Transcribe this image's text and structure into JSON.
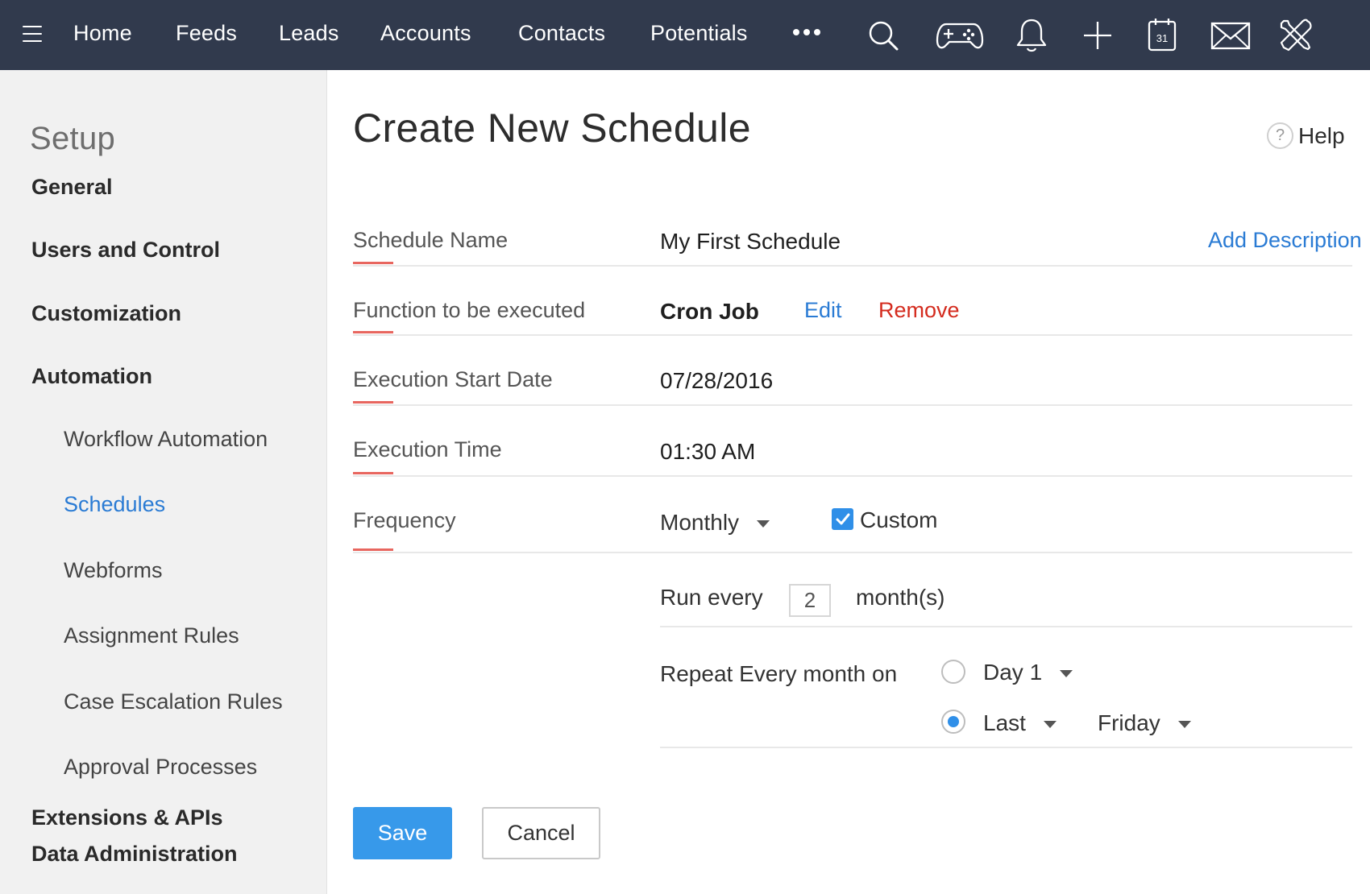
{
  "topbar": {
    "nav": [
      "Home",
      "Feeds",
      "Leads",
      "Accounts",
      "Contacts",
      "Potentials"
    ],
    "icons": [
      "menu-icon",
      "more-icon",
      "search-icon",
      "gamepad-icon",
      "bell-icon",
      "plus-icon",
      "calendar-icon",
      "mail-icon",
      "tools-icon"
    ],
    "calendar_day": "31",
    "background": "#313a4d"
  },
  "sidebar": {
    "title": "Setup",
    "sections": [
      {
        "label": "General"
      },
      {
        "label": "Users and Control"
      },
      {
        "label": "Customization"
      },
      {
        "label": "Automation"
      }
    ],
    "automation_items": [
      {
        "label": "Workflow Automation",
        "active": false
      },
      {
        "label": "Schedules",
        "active": true
      },
      {
        "label": "Webforms",
        "active": false
      },
      {
        "label": "Assignment Rules",
        "active": false
      },
      {
        "label": "Case Escalation Rules",
        "active": false
      },
      {
        "label": "Approval Processes",
        "active": false
      }
    ],
    "bottom_sections": [
      {
        "label": "Extensions & APIs"
      },
      {
        "label": "Data Administration"
      }
    ]
  },
  "main": {
    "title": "Create New Schedule",
    "help_label": "Help",
    "help_icon": "?",
    "fields": {
      "schedule_name": {
        "label": "Schedule Name",
        "value": "My First Schedule",
        "link": "Add Description"
      },
      "function": {
        "label": "Function to be executed",
        "value": "Cron Job",
        "edit": "Edit",
        "remove": "Remove"
      },
      "start_date": {
        "label": "Execution Start Date",
        "value": "07/28/2016"
      },
      "time": {
        "label": "Execution Time",
        "value": "01:30 AM"
      },
      "frequency": {
        "label": "Frequency",
        "value": "Monthly",
        "custom_label": "Custom",
        "custom_checked": true
      }
    },
    "run_every": {
      "prefix": "Run every",
      "value": "2",
      "suffix": "month(s)"
    },
    "repeat": {
      "label": "Repeat Every month on",
      "option_day": {
        "value": "Day 1",
        "selected": false
      },
      "option_last": {
        "value": "Last",
        "weekday": "Friday",
        "selected": true
      }
    },
    "buttons": {
      "save": "Save",
      "cancel": "Cancel"
    }
  },
  "colors": {
    "accent": "#2a7bd4",
    "save_button": "#3799ea",
    "remove": "#d42b1e",
    "label_underline": "#e8665f"
  }
}
